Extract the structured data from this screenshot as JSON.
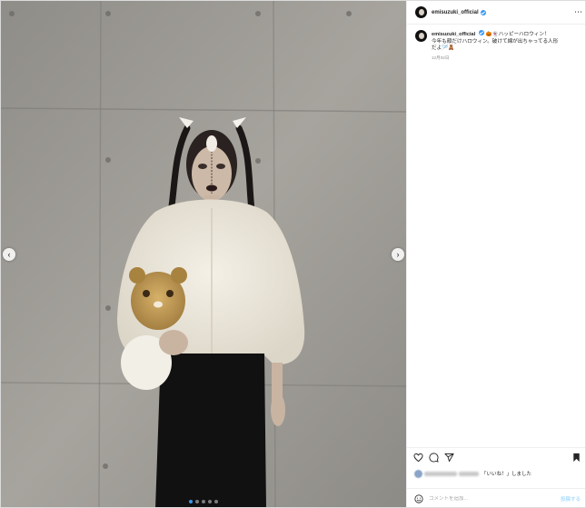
{
  "post": {
    "username": "emisuzuki_official",
    "caption_username": "emisuzuki_official",
    "caption_line1": "🎃👻ハッピーハロウィン！",
    "caption_line2": "今年も顔だけハロウィン。破けて綿が出ちゃってる人形",
    "caption_line3": "だよ🪡🧸",
    "timestamp": "12月02日"
  },
  "media": {
    "carousel_count": 5,
    "active_index": 0,
    "prev_icon": "chevron-left-icon",
    "next_icon": "chevron-right-icon"
  },
  "actions": {
    "icons": [
      "heart-icon",
      "comment-icon",
      "share-icon",
      "bookmark-icon"
    ]
  },
  "likes": {
    "text": "「いいね！」しました"
  },
  "comment": {
    "placeholder": "コメントを追加...",
    "post_label": "投稿する"
  },
  "colors": {
    "accent": "#3897f0",
    "post_disabled": "#b2dffc",
    "border": "#dbdbdb"
  }
}
